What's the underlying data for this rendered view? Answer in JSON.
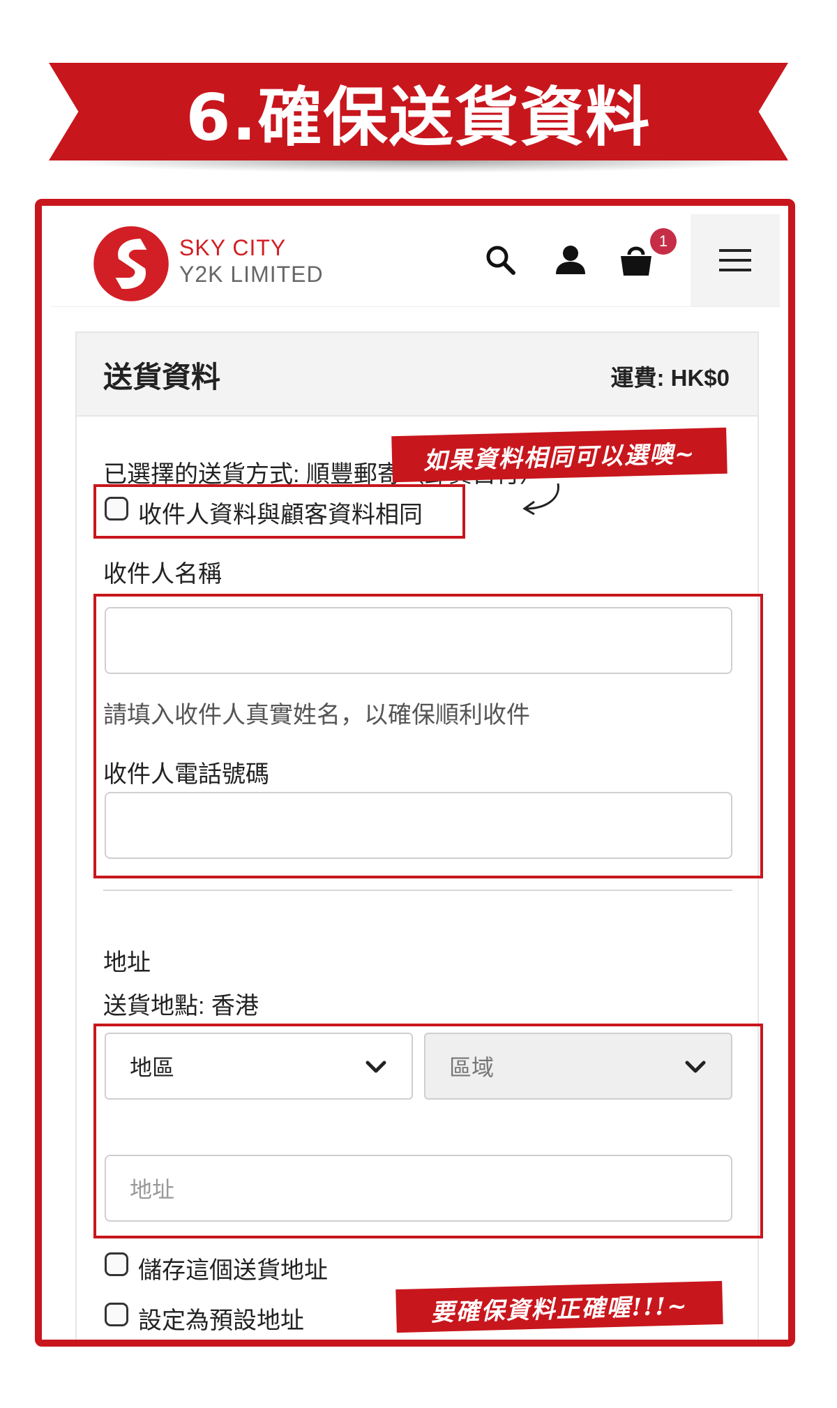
{
  "banner": {
    "title": "6.確保送貨資料"
  },
  "header": {
    "logo_line1": "SKY CITY",
    "logo_line2": "Y2K LIMITED",
    "cart_count": "1",
    "icons": [
      "search-icon",
      "user-icon",
      "bag-icon",
      "hamburger-menu-icon"
    ]
  },
  "card": {
    "title": "送貨資料",
    "shipping_fee": "運費: HK$0",
    "selected_method": "已選擇的送貨方式: 順豐郵寄（郵費自付）",
    "same_as_customer_label": "收件人資料與顧客資料相同",
    "recipient_name_label": "收件人名稱",
    "recipient_name_value": "",
    "recipient_name_hint": "請填入收件人真實姓名，以確保順利收件",
    "recipient_phone_label": "收件人電話號碼",
    "recipient_phone_value": "",
    "address_label": "地址",
    "delivery_location": "送貨地點: 香港",
    "district_select": "地區",
    "area_select": "區域",
    "address_placeholder": "地址",
    "save_address_label": "儲存這個送貨地址",
    "set_default_label": "設定為預設地址"
  },
  "annotations": {
    "note_same_info": "如果資料相同可以選噢~",
    "note_confirm": "要確保資料正確喔!!!~"
  },
  "colors": {
    "accent": "#c8161d",
    "badge": "#c62d47",
    "header_bg": "#f3f3f3"
  }
}
